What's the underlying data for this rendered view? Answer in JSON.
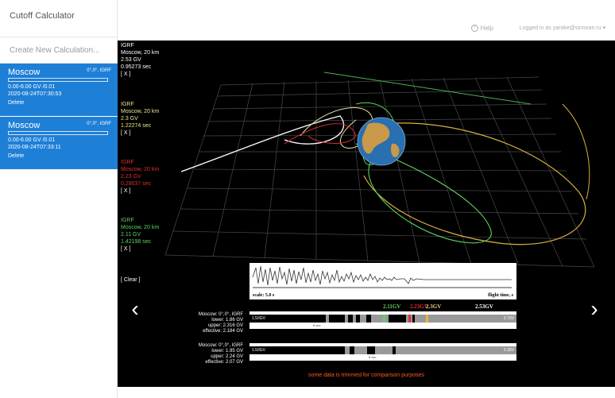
{
  "app": {
    "title": "Cutoff Calculator"
  },
  "sidebar": {
    "create_label": "Create New Calculation...",
    "calculations": [
      {
        "name": "Moscow",
        "tag": "0°,0°, IGRF",
        "params": "0.00-6.00 GV /0.01",
        "date": "2020-08-24T07:30:53",
        "delete_label": "Delete",
        "progress": 1.0
      },
      {
        "name": "Moscow",
        "tag": "0°,0°, IGRF",
        "params": "0.00-6.00 GV /0.01",
        "date": "2020-08-24T07:33:11",
        "delete_label": "Delete",
        "progress": 1.0
      }
    ]
  },
  "header": {
    "help_label": "Help",
    "user_label": "Logged in as yaroke@sinnoan.ru ▾"
  },
  "viewer": {
    "legend": [
      {
        "model": "IGRF",
        "location": "Moscow, 20 km",
        "rigidity": "2.53 GV",
        "time": "0.95273 sec",
        "close": "[ X ]",
        "color": "#ffffff"
      },
      {
        "model": "IGRF",
        "location": "Moscow, 20 km",
        "rigidity": "2.3 GV",
        "time": "1.22274 sec",
        "close": "[ X ]",
        "color": "#f0e68c"
      },
      {
        "model": "IGRF",
        "location": "Moscow, 20 km",
        "rigidity": "2.23 GV",
        "time": "0.28037 sec",
        "close": "[ X ]",
        "color": "#e03030"
      },
      {
        "model": "IGRF",
        "location": "Moscow, 20 km",
        "rigidity": "2.11 GV",
        "time": "1.42198 sec",
        "close": "[ X ]",
        "color": "#5fd35f"
      }
    ],
    "clear_label": "[ Clear ]",
    "prev_arrow": "‹",
    "next_arrow": "›",
    "flight_panel": {
      "scale_label": "scale: 5.0 s",
      "time_label": "flight time, s"
    },
    "gv_markers": [
      {
        "label": "2.11GV",
        "color": "#5fd35f"
      },
      {
        "label": "2.23GV",
        "color": "#e03030"
      },
      {
        "label": "2.3GV",
        "color": "#e8d08a"
      },
      {
        "label": "2.53GV",
        "color": "#000000"
      }
    ],
    "cutoff_rows": [
      {
        "title": "Moscow: 0°,0°, IGRF",
        "lower": "lower: 1.86 GV",
        "upper": "upper: 2.316 GV",
        "effective": "effective: 2.184 GV",
        "left_gv": "1.5/IGV",
        "right_gv": "2.70V",
        "small_label": "8 sec"
      },
      {
        "title": "Moscow: 0°,0°, IGRF",
        "lower": "lower: 1.95 GV",
        "upper": "upper: 2.24 GV",
        "effective": "effective: 2.07 GV",
        "left_gv": "1.5/IGV",
        "right_gv": "2.30V",
        "small_label": "8 sec"
      }
    ],
    "note": "some data is trimmed for comparison purposes"
  }
}
